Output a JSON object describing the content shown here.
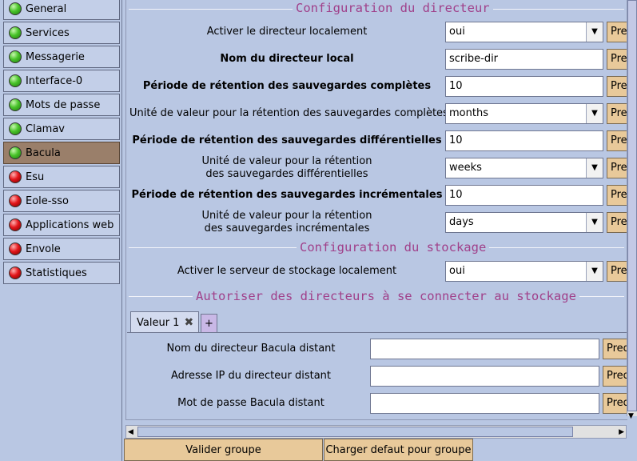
{
  "sidebar": {
    "items": [
      {
        "label": "General",
        "status": "green"
      },
      {
        "label": "Services",
        "status": "green"
      },
      {
        "label": "Messagerie",
        "status": "green"
      },
      {
        "label": "Interface-0",
        "status": "green"
      },
      {
        "label": "Mots de passe",
        "status": "green"
      },
      {
        "label": "Clamav",
        "status": "green"
      },
      {
        "label": "Bacula",
        "status": "green",
        "active": true
      },
      {
        "label": "Esu",
        "status": "red"
      },
      {
        "label": "Eole-sso",
        "status": "red"
      },
      {
        "label": "Applications web",
        "status": "red"
      },
      {
        "label": "Envole",
        "status": "red"
      },
      {
        "label": "Statistiques",
        "status": "red"
      }
    ]
  },
  "main": {
    "section_director": "Configuration du directeur",
    "section_storage": "Configuration du stockage",
    "section_allow": "Autoriser des directeurs à se connecter au stockage",
    "preset_label": "Pre",
    "fields": [
      {
        "label": "Activer le directeur localement",
        "bold": false,
        "type": "select",
        "value": "oui"
      },
      {
        "label": "Nom du directeur local",
        "bold": true,
        "type": "input",
        "value": "scribe-dir"
      },
      {
        "label": "Période de rétention des sauvegardes complètes",
        "bold": true,
        "type": "input",
        "value": "10"
      },
      {
        "label": "Unité de valeur pour la rétention des sauvegardes complètes",
        "bold": false,
        "type": "select",
        "value": "months"
      },
      {
        "label": "Période de rétention des sauvegardes différentielles",
        "bold": true,
        "type": "input",
        "value": "10"
      },
      {
        "label_line1": "Unité de valeur pour la rétention",
        "label_line2": "des sauvegardes différentielles",
        "bold": false,
        "type": "select",
        "value": "weeks"
      },
      {
        "label": "Période de rétention des sauvegardes incrémentales",
        "bold": true,
        "type": "input",
        "value": "10"
      },
      {
        "label_line1": "Unité de valeur pour la rétention",
        "label_line2": "des sauvegardes incrémentales",
        "bold": false,
        "type": "select",
        "value": "days"
      },
      {
        "label": "Activer le serveur de stockage localement",
        "bold": false,
        "type": "select",
        "value": "oui"
      }
    ],
    "tabs": {
      "tab1_label": "Valeur 1",
      "add_label": "+"
    },
    "remote_fields": [
      {
        "label": "Nom du directeur Bacula distant",
        "value": ""
      },
      {
        "label": "Adresse IP du directeur distant",
        "value": ""
      },
      {
        "label": "Mot de passe Bacula distant",
        "value": ""
      }
    ],
    "remote_preset_label": "Pred"
  },
  "footer": {
    "validate_label": "Valider groupe",
    "load_default_label": "Charger defaut pour groupe"
  },
  "colors": {
    "background": "#b9c7e3",
    "section_title": "#a0408a",
    "button": "#e8c99a",
    "active_item": "#9a7f6a"
  }
}
